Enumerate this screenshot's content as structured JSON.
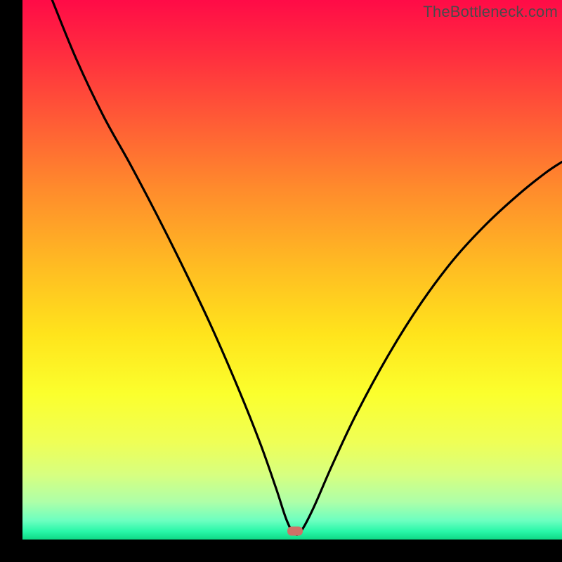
{
  "watermark": {
    "text": "TheBottleneck.com"
  },
  "marker": {
    "color": "#cf7167",
    "x_frac": 0.505,
    "y_frac": 0.985
  },
  "gradient_stops": [
    {
      "offset": 0.0,
      "color": "#ff0b47"
    },
    {
      "offset": 0.1,
      "color": "#ff2d3f"
    },
    {
      "offset": 0.22,
      "color": "#ff5a36"
    },
    {
      "offset": 0.35,
      "color": "#ff8b2c"
    },
    {
      "offset": 0.5,
      "color": "#ffbe22"
    },
    {
      "offset": 0.62,
      "color": "#ffe41c"
    },
    {
      "offset": 0.73,
      "color": "#fbff2d"
    },
    {
      "offset": 0.82,
      "color": "#efff56"
    },
    {
      "offset": 0.88,
      "color": "#d7ff80"
    },
    {
      "offset": 0.93,
      "color": "#aeffa8"
    },
    {
      "offset": 0.965,
      "color": "#6cffc0"
    },
    {
      "offset": 0.985,
      "color": "#28f7a8"
    },
    {
      "offset": 1.0,
      "color": "#0fd885"
    }
  ],
  "chart_data": {
    "type": "line",
    "title": "",
    "xlabel": "",
    "ylabel": "",
    "xlim": [
      0,
      1
    ],
    "ylim": [
      0,
      1
    ],
    "series": [
      {
        "name": "bottleneck-curve",
        "points": [
          {
            "x": 0.055,
            "y": 1.0
          },
          {
            "x": 0.1,
            "y": 0.89
          },
          {
            "x": 0.15,
            "y": 0.785
          },
          {
            "x": 0.2,
            "y": 0.695
          },
          {
            "x": 0.25,
            "y": 0.6
          },
          {
            "x": 0.3,
            "y": 0.5
          },
          {
            "x": 0.35,
            "y": 0.395
          },
          {
            "x": 0.4,
            "y": 0.28
          },
          {
            "x": 0.44,
            "y": 0.18
          },
          {
            "x": 0.47,
            "y": 0.095
          },
          {
            "x": 0.49,
            "y": 0.035
          },
          {
            "x": 0.505,
            "y": 0.01
          },
          {
            "x": 0.518,
            "y": 0.018
          },
          {
            "x": 0.54,
            "y": 0.06
          },
          {
            "x": 0.575,
            "y": 0.14
          },
          {
            "x": 0.62,
            "y": 0.235
          },
          {
            "x": 0.68,
            "y": 0.345
          },
          {
            "x": 0.74,
            "y": 0.44
          },
          {
            "x": 0.8,
            "y": 0.52
          },
          {
            "x": 0.86,
            "y": 0.585
          },
          {
            "x": 0.92,
            "y": 0.64
          },
          {
            "x": 0.97,
            "y": 0.68
          },
          {
            "x": 1.0,
            "y": 0.7
          }
        ]
      }
    ]
  }
}
